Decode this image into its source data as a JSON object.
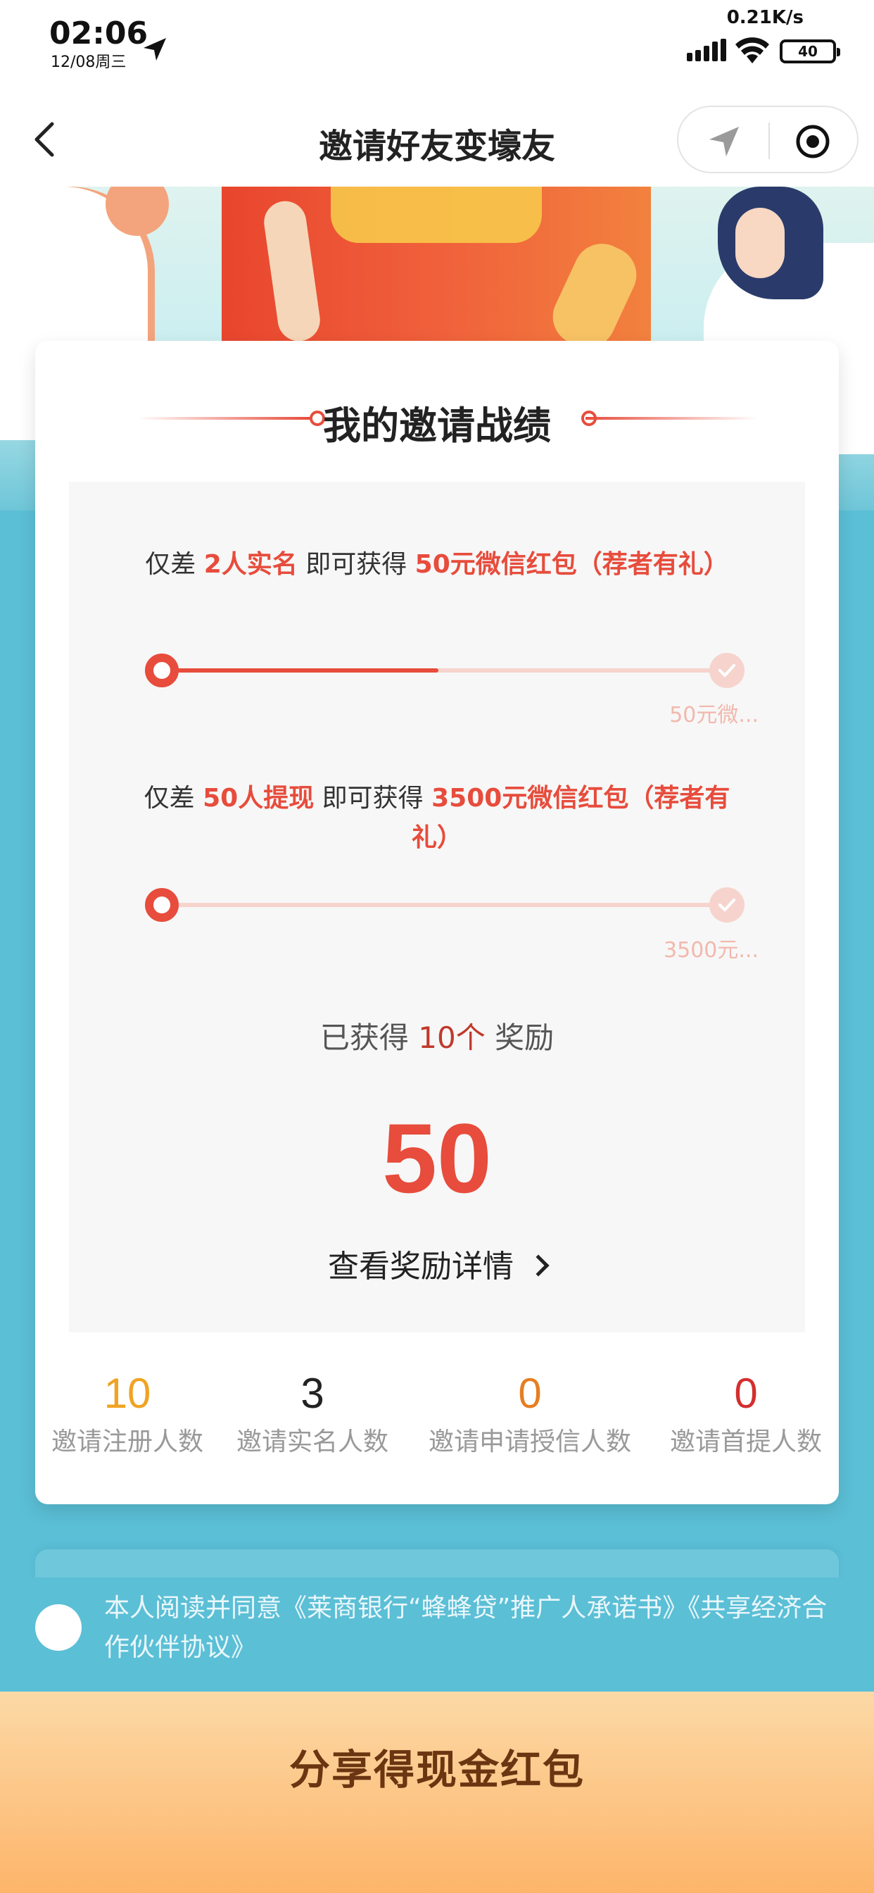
{
  "status_bar": {
    "time": "02:06",
    "date": "12/08周三",
    "speed": "0.21K/s",
    "battery": "40"
  },
  "nav": {
    "title": "邀请好友变壕友"
  },
  "card": {
    "title": "我的邀请战绩",
    "goals": [
      {
        "prefix": "仅差 ",
        "count": "2人实名",
        "middle": " 即可获得 ",
        "reward": "50元微信红包（荐者有礼）",
        "progress": 0.5,
        "end_label": "50元微..."
      },
      {
        "prefix": "仅差 ",
        "count": "50人提现",
        "middle": " 即可获得 ",
        "reward": "3500元微信红包（荐者有礼）",
        "progress": 0,
        "end_label": "3500元..."
      }
    ],
    "reward_prefix": "已获得 ",
    "reward_count": "10个",
    "reward_suffix": " 奖励",
    "reward_amount": "50",
    "reward_link": "查看奖励详情",
    "stats": [
      {
        "value": "10",
        "label": "邀请注册人数",
        "color": "#f0a323"
      },
      {
        "value": "3",
        "label": "邀请实名人数",
        "color": "#222222"
      },
      {
        "value": "0",
        "label": "邀请申请授信人数",
        "color": "#e67e22"
      },
      {
        "value": "0",
        "label": "邀请首提人数",
        "color": "#d32f2f"
      }
    ]
  },
  "agreement": {
    "text": "本人阅读并同意《莱商银行“蜂蜂贷”推广人承诺书》《共享经济合作伙伴协议》",
    "checked": false
  },
  "share_button": {
    "label": "分享得现金红包"
  },
  "colors": {
    "accent": "#e74c3c",
    "background": "#5bbfd6",
    "button_gradient_top": "#fcd9a6",
    "button_gradient_bottom": "#fdb56a"
  }
}
